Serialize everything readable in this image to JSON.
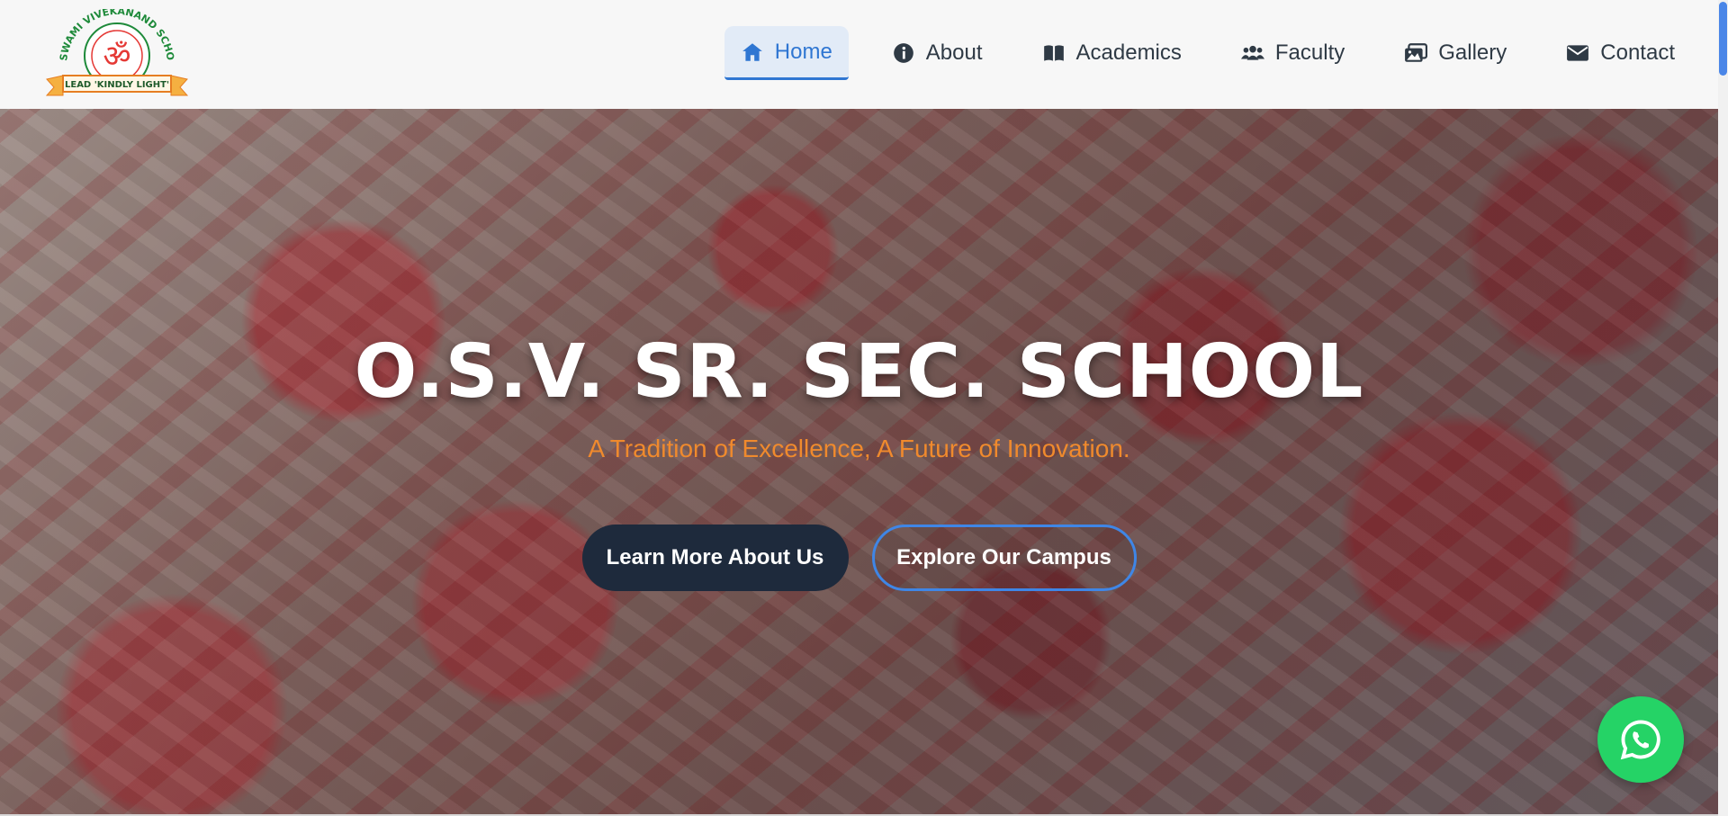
{
  "header": {
    "logo": {
      "arc_text": "SWAMI VIVEKANAND SCHOOL",
      "ribbon_text": "LEAD 'KINDLY LIGHT'",
      "symbol": "ॐ"
    },
    "nav": [
      {
        "label": "Home",
        "icon": "home-icon",
        "active": true
      },
      {
        "label": "About",
        "icon": "info-icon",
        "active": false
      },
      {
        "label": "Academics",
        "icon": "book-icon",
        "active": false
      },
      {
        "label": "Faculty",
        "icon": "users-icon",
        "active": false
      },
      {
        "label": "Gallery",
        "icon": "images-icon",
        "active": false
      },
      {
        "label": "Contact",
        "icon": "envelope-icon",
        "active": false
      }
    ]
  },
  "hero": {
    "title": "O.S.V. SR. SEC. SCHOOL",
    "subtitle": "A Tradition of Excellence, A Future of Innovation.",
    "buttons": {
      "primary": "Learn More About Us",
      "secondary": "Explore Our Campus"
    }
  },
  "floating": {
    "icon": "whatsapp-icon"
  },
  "colors": {
    "accent": "#2f76d2",
    "subtitle": "#f08a2d",
    "primary_button": "#1e2a3c",
    "whatsapp": "#25d366"
  }
}
